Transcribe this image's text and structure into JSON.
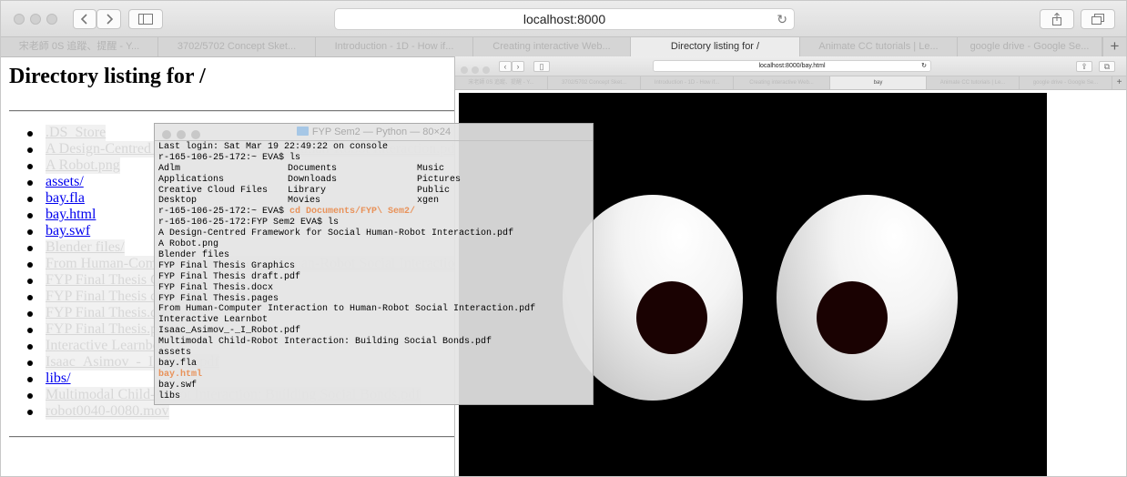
{
  "toolbar": {
    "address": "localhost:8000",
    "back_icon": "back-chevron-icon",
    "forward_icon": "forward-chevron-icon",
    "sidebar_icon": "sidebar-icon",
    "share_icon": "share-icon",
    "tabs_icon": "tabs-overview-icon",
    "reload_icon": "reload-icon"
  },
  "tabs": [
    "宋老師 0S 追蹤、提醒 - Y...",
    "3702/5702 Concept Sket...",
    "Introduction - 1D - How if...",
    "Creating interactive Web...",
    "Directory listing for /",
    "Animate CC tutorials | Le...",
    "google drive - Google Se..."
  ],
  "page": {
    "title": "Directory listing for /",
    "files": [
      {
        "name": ".DS_Store",
        "dim": true
      },
      {
        "name": "A Design-Centred Framework for Social Human-Robot Interaction.pdf",
        "dim": true
      },
      {
        "name": "A Robot.png",
        "dim": true
      },
      {
        "name": "assets/",
        "dim": false
      },
      {
        "name": "bay.fla",
        "dim": false
      },
      {
        "name": "bay.html",
        "dim": false
      },
      {
        "name": "bay.swf",
        "dim": false
      },
      {
        "name": "Blender files/",
        "dim": true
      },
      {
        "name": "From Human-Computer Interaction to Human-Robot Social Interaction.pdf",
        "dim": true
      },
      {
        "name": "FYP Final Thesis Graphics/",
        "dim": true
      },
      {
        "name": "FYP Final Thesis draft.pdf",
        "dim": true
      },
      {
        "name": "FYP Final Thesis.docx",
        "dim": true
      },
      {
        "name": "FYP Final Thesis.pages",
        "dim": true
      },
      {
        "name": "Interactive Learnbot/",
        "dim": true
      },
      {
        "name": "Isaac_Asimov_-_I_Robot.pdf",
        "dim": true
      },
      {
        "name": "libs/",
        "dim": false
      },
      {
        "name": "Multimodal Child-Robot Interaction: Building Social Bonds.pdf",
        "dim": true
      },
      {
        "name": "robot0040-0080.mov",
        "dim": true
      }
    ]
  },
  "second_window": {
    "address": "localhost:8000/bay.html",
    "tabs": [
      "宋老師 0S 追蹤、提醒 - Y...",
      "3702/5702 Concept Sket...",
      "Introduction - 1D - How if...",
      "Creating interactive Web...",
      "bay",
      "Animate CC tutorials | Le...",
      "google drive - Google Se..."
    ]
  },
  "terminal": {
    "title": "FYP Sem2 — Python — 80×24",
    "login": "Last login: Sat Mar 19 22:49:22 on console",
    "prompt1": "r-165-106-25-172:~ EVA$ ls",
    "ls_col1": [
      "Adlm",
      "Applications",
      "Creative Cloud Files",
      "Desktop"
    ],
    "ls_col2": [
      "Documents",
      "Downloads",
      "Library",
      "Movies"
    ],
    "ls_col3": [
      "Music",
      "Pictures",
      "Public",
      "xgen"
    ],
    "prompt2": "r-165-106-25-172:~ EVA$ ",
    "cd_cmd": "cd Documents/FYP\\ Sem2/",
    "prompt3": "r-165-106-25-172:FYP Sem2 EVA$ ls",
    "files": [
      {
        "text": "A Design-Centred Framework for Social Human-Robot Interaction.pdf",
        "highlight": false
      },
      {
        "text": "A Robot.png",
        "highlight": false
      },
      {
        "text": "Blender files",
        "highlight": false
      },
      {
        "text": "FYP Final Thesis Graphics",
        "highlight": false
      },
      {
        "text": "FYP Final Thesis draft.pdf",
        "highlight": false
      },
      {
        "text": "FYP Final Thesis.docx",
        "highlight": false
      },
      {
        "text": "FYP Final Thesis.pages",
        "highlight": false
      },
      {
        "text": "From Human-Computer Interaction to Human-Robot Social Interaction.pdf",
        "highlight": false
      },
      {
        "text": "Interactive Learnbot",
        "highlight": false
      },
      {
        "text": "Isaac_Asimov_-_I_Robot.pdf",
        "highlight": false
      },
      {
        "text": "Multimodal Child-Robot Interaction: Building Social Bonds.pdf",
        "highlight": false
      },
      {
        "text": "assets",
        "highlight": false
      },
      {
        "text": "bay.fla",
        "highlight": false
      },
      {
        "text": "bay.html",
        "highlight": true
      },
      {
        "text": "bay.swf",
        "highlight": false
      },
      {
        "text": "libs",
        "highlight": false
      }
    ]
  },
  "colors": {
    "highlight": "#e8925a",
    "link": "#0000ee",
    "stage": "#000000",
    "pupil": "#1a0202"
  }
}
